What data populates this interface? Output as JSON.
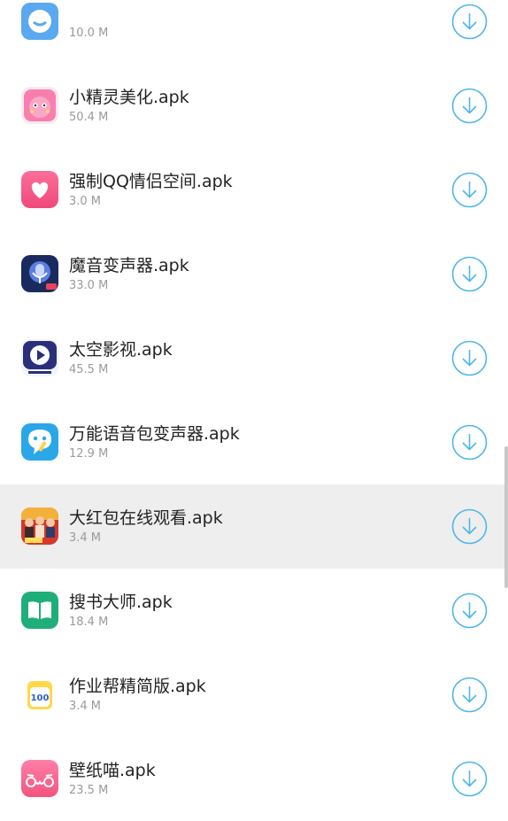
{
  "theme": {
    "accent": "#4fb6ea",
    "highlight_row": "#eeeeee"
  },
  "files": [
    {
      "name": "",
      "size": "10.0 M",
      "icon": "app-icon-blue-face"
    },
    {
      "name": "小精灵美化.apk",
      "size": "50.4 M",
      "icon": "app-icon-pink-cat"
    },
    {
      "name": "强制QQ情侣空间.apk",
      "size": "3.0 M",
      "icon": "app-icon-pink-heart"
    },
    {
      "name": "魔音变声器.apk",
      "size": "33.0 M",
      "icon": "app-icon-microphone"
    },
    {
      "name": "太空影视.apk",
      "size": "45.5 M",
      "icon": "app-icon-play"
    },
    {
      "name": "万能语音包变声器.apk",
      "size": "12.9 M",
      "icon": "app-icon-voice-bubble"
    },
    {
      "name": "大红包在线观看.apk",
      "size": "3.4 M",
      "icon": "app-icon-movie-poster",
      "highlighted": true
    },
    {
      "name": "搜书大师.apk",
      "size": "18.4 M",
      "icon": "app-icon-book"
    },
    {
      "name": "作业帮精简版.apk",
      "size": "3.4 M",
      "icon": "app-icon-100-card"
    },
    {
      "name": "壁纸喵.apk",
      "size": "23.5 M",
      "icon": "app-icon-owo-face"
    }
  ]
}
